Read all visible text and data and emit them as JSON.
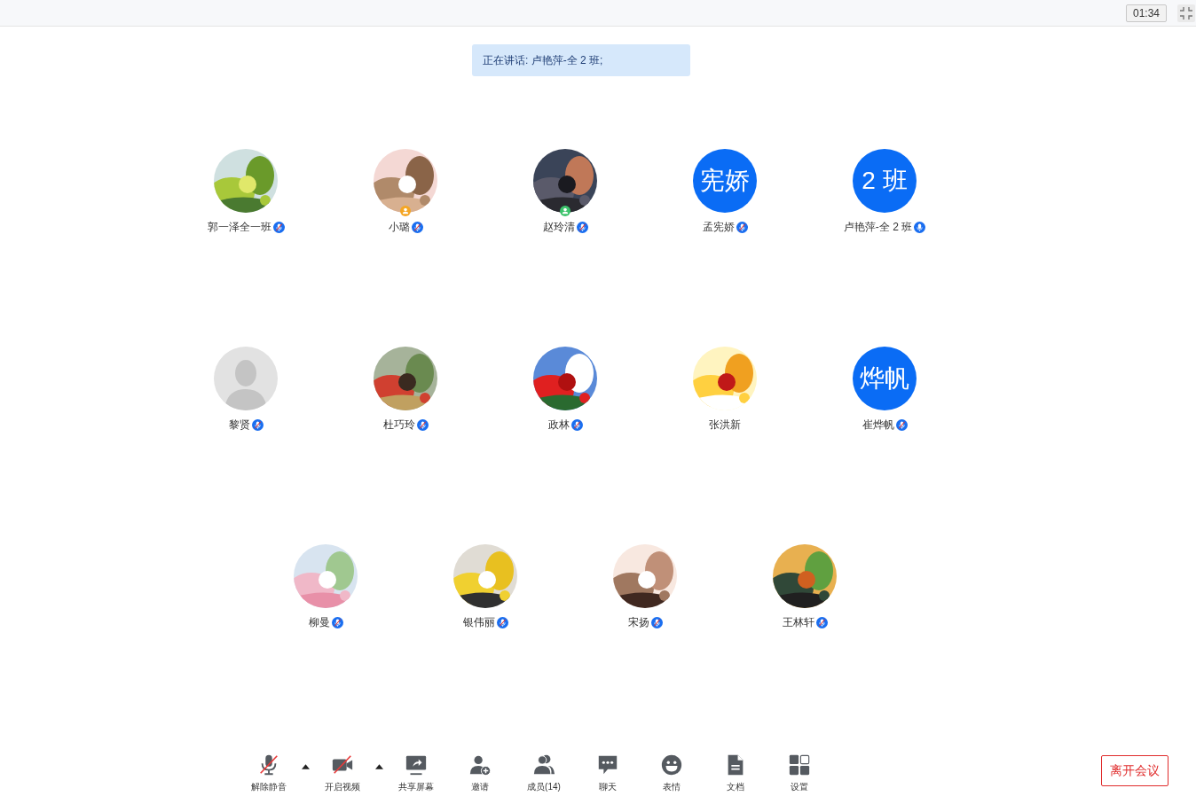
{
  "top_bar": {
    "timer": "01:34"
  },
  "speaking_banner": "正在讲话: 卢艳萍-全 2 班;",
  "participant_rows": [
    [
      {
        "name": "郭一泽全一班",
        "host": false,
        "cohost": false,
        "mic": {
          "muted": true
        }
      },
      {
        "name": "小璐",
        "host": true,
        "cohost": false,
        "mic": {
          "muted": true
        }
      },
      {
        "name": "赵玲清",
        "host": false,
        "cohost": true,
        "mic": {
          "muted": true
        }
      },
      {
        "name": "孟宪娇",
        "avatar": {
          "kind": "text",
          "text": "宪娇"
        },
        "host": false,
        "cohost": false,
        "mic": {
          "muted": true
        }
      },
      {
        "name": "卢艳萍-全 2 班",
        "avatar": {
          "kind": "text",
          "text": "2 班"
        },
        "host": false,
        "cohost": false,
        "mic": {
          "muted": false
        }
      }
    ],
    [
      {
        "name": "黎贤",
        "avatar": {
          "kind": "default"
        },
        "host": false,
        "cohost": false,
        "mic": {
          "muted": true
        }
      },
      {
        "name": "杜巧玲",
        "host": false,
        "cohost": false,
        "mic": {
          "muted": true
        }
      },
      {
        "name": "政林",
        "host": false,
        "cohost": false,
        "mic": {
          "muted": true
        }
      },
      {
        "name": "张洪新",
        "host": false,
        "cohost": false
      },
      {
        "name": "崔烨帆",
        "avatar": {
          "kind": "text",
          "text": "烨帆"
        },
        "host": false,
        "cohost": false,
        "mic": {
          "muted": true
        }
      }
    ],
    [
      {
        "name": "柳曼",
        "host": false,
        "cohost": false,
        "mic": {
          "muted": true
        }
      },
      {
        "name": "银伟丽",
        "host": false,
        "cohost": false,
        "mic": {
          "muted": true
        }
      },
      {
        "name": "宋扬",
        "host": false,
        "cohost": false,
        "mic": {
          "muted": true
        }
      },
      {
        "name": "王林轩",
        "host": false,
        "cohost": false,
        "mic": {
          "muted": true
        }
      }
    ]
  ],
  "toolbar": [
    {
      "kind": "mic",
      "label": "解除静音",
      "off": true,
      "caret": true
    },
    {
      "kind": "video",
      "label": "开启视频",
      "off": true,
      "caret": true
    },
    {
      "kind": "share",
      "label": "共享屏幕"
    },
    {
      "kind": "invite",
      "label": "邀请"
    },
    {
      "kind": "members",
      "label": "成员(14)"
    },
    {
      "kind": "chat",
      "label": "聊天"
    },
    {
      "kind": "emoji",
      "label": "表情"
    },
    {
      "kind": "docs",
      "label": "文档"
    },
    {
      "kind": "settings",
      "label": "设置"
    }
  ],
  "leave_button": "离开会议"
}
